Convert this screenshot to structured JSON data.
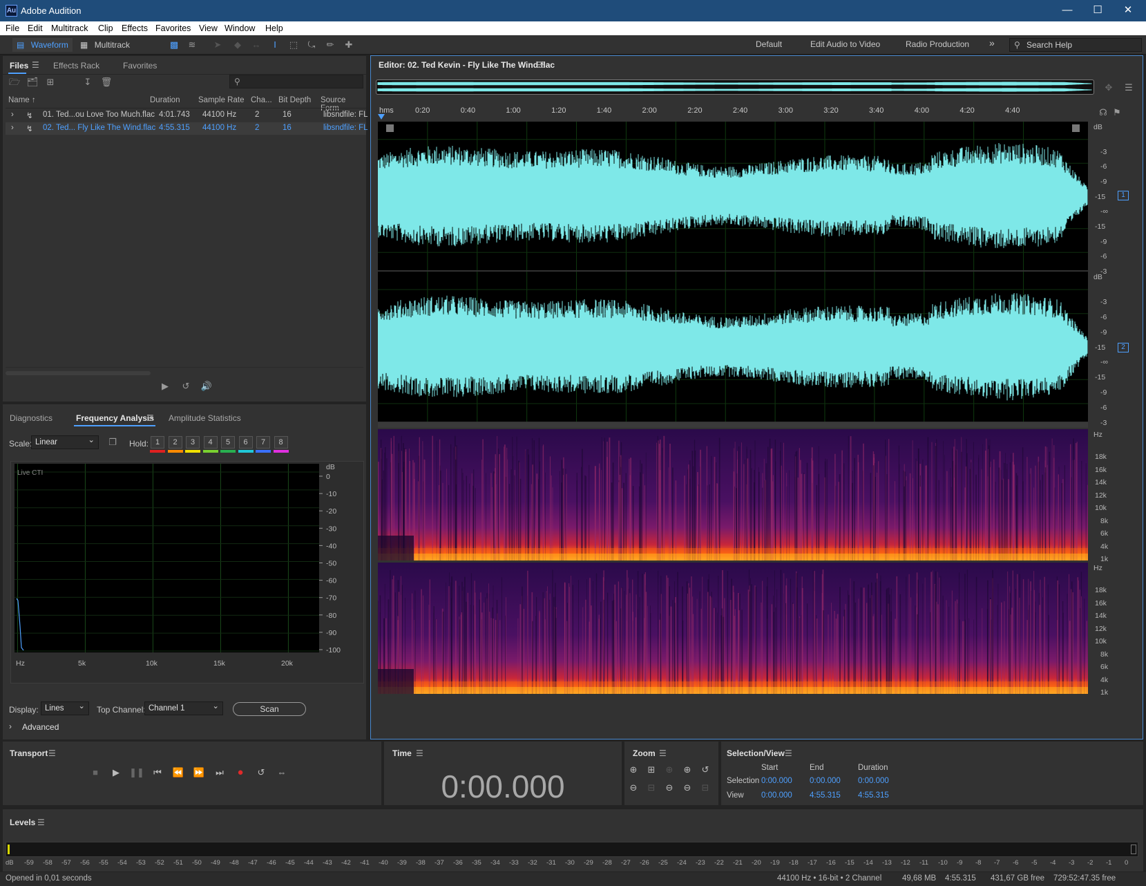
{
  "window": {
    "title": "Adobe Audition",
    "logo": "Au"
  },
  "menu": [
    "File",
    "Edit",
    "Multitrack",
    "Clip",
    "Effects",
    "Favorites",
    "View",
    "Window",
    "Help"
  ],
  "toolbar": {
    "waveform_label": "Waveform",
    "multitrack_label": "Multitrack",
    "workspaces": [
      "Default",
      "Edit Audio to Video",
      "Radio Production"
    ],
    "more": "»",
    "search_placeholder": "Search Help"
  },
  "files_panel": {
    "tabs": [
      "Files",
      "Effects Rack",
      "Favorites"
    ],
    "columns": [
      "Name ↑",
      "Duration",
      "Sample Rate",
      "Cha...",
      "Bit Depth",
      "Source Form"
    ],
    "rows": [
      {
        "name": "01. Ted...ou Love Too Much.flac",
        "duration": "4:01.743",
        "sample_rate": "44100 Hz",
        "channels": "2",
        "bit_depth": "16",
        "source": "libsndfile: FL",
        "selected": false
      },
      {
        "name": "02. Ted... Fly Like The Wind.flac",
        "duration": "4:55.315",
        "sample_rate": "44100 Hz",
        "channels": "2",
        "bit_depth": "16",
        "source": "libsndfile: FL",
        "selected": true
      }
    ]
  },
  "freq_panel": {
    "tabs": [
      "Diagnostics",
      "Frequency Analysis",
      "Amplitude Statistics"
    ],
    "scale_label": "Scale:",
    "scale_value": "Linear",
    "hold_label": "Hold:",
    "holds": [
      "1",
      "2",
      "3",
      "4",
      "5",
      "6",
      "7",
      "8"
    ],
    "hold_colors": [
      "#e02020",
      "#ff8a00",
      "#f0e000",
      "#7ad030",
      "#28b050",
      "#20c8d8",
      "#3a70ff",
      "#e030e0"
    ],
    "graph_label": "Live CTI",
    "db_label": "dB",
    "db_ticks": [
      "0",
      "-10",
      "-20",
      "-30",
      "-40",
      "-50",
      "-60",
      "-70",
      "-80",
      "-90",
      "-100"
    ],
    "hz_ticks": [
      "Hz",
      "5k",
      "10k",
      "15k",
      "20k"
    ],
    "display_label": "Display:",
    "display_value": "Lines",
    "top_channel_label": "Top Channel:",
    "top_channel_value": "Channel 1",
    "scan_label": "Scan",
    "advanced_label": "Advanced"
  },
  "editor": {
    "title": "Editor: 02. Ted Kevin - Fly Like The Wind.flac",
    "time_label": "hms",
    "time_ticks": [
      "0:20",
      "0:40",
      "1:00",
      "1:20",
      "1:40",
      "2:00",
      "2:20",
      "2:40",
      "3:00",
      "3:20",
      "3:40",
      "4:00",
      "4:20",
      "4:40"
    ],
    "db_scale": [
      "dB",
      "-3",
      "-6",
      "-9",
      "-15",
      "-∞",
      "-15",
      "-9",
      "-6",
      "-3"
    ],
    "hz_scale": [
      "Hz",
      "18k",
      "16k",
      "14k",
      "12k",
      "10k",
      "8k",
      "6k",
      "4k",
      "1k"
    ],
    "channels": [
      "1",
      "2"
    ],
    "wave_color": "#7ee8e8"
  },
  "transport": {
    "title": "Transport"
  },
  "time_panel": {
    "title": "Time",
    "value": "0:00.000"
  },
  "zoom_panel": {
    "title": "Zoom"
  },
  "selection_view": {
    "title": "Selection/View",
    "headers": [
      "Start",
      "End",
      "Duration"
    ],
    "selection_label": "Selection",
    "view_label": "View",
    "selection": [
      "0:00.000",
      "0:00.000",
      "0:00.000"
    ],
    "view": [
      "0:00.000",
      "4:55.315",
      "4:55.315"
    ]
  },
  "levels": {
    "title": "Levels",
    "scale": [
      "dB",
      "-59",
      "-58",
      "-57",
      "-56",
      "-55",
      "-54",
      "-53",
      "-52",
      "-51",
      "-50",
      "-49",
      "-48",
      "-47",
      "-46",
      "-45",
      "-44",
      "-43",
      "-42",
      "-41",
      "-40",
      "-39",
      "-38",
      "-37",
      "-36",
      "-35",
      "-34",
      "-33",
      "-32",
      "-31",
      "-30",
      "-29",
      "-28",
      "-27",
      "-26",
      "-25",
      "-24",
      "-23",
      "-22",
      "-21",
      "-20",
      "-19",
      "-18",
      "-17",
      "-16",
      "-15",
      "-14",
      "-13",
      "-12",
      "-11",
      "-10",
      "-9",
      "-8",
      "-7",
      "-6",
      "-5",
      "-4",
      "-3",
      "-2",
      "-1",
      "0"
    ]
  },
  "status": {
    "left": "Opened in 0,01 seconds",
    "format": "44100 Hz • 16-bit • 2 Channel",
    "size": "49,68 MB",
    "duration": "4:55.315",
    "free": "431,67 GB free",
    "time_free": "729:52:47.35 free"
  }
}
